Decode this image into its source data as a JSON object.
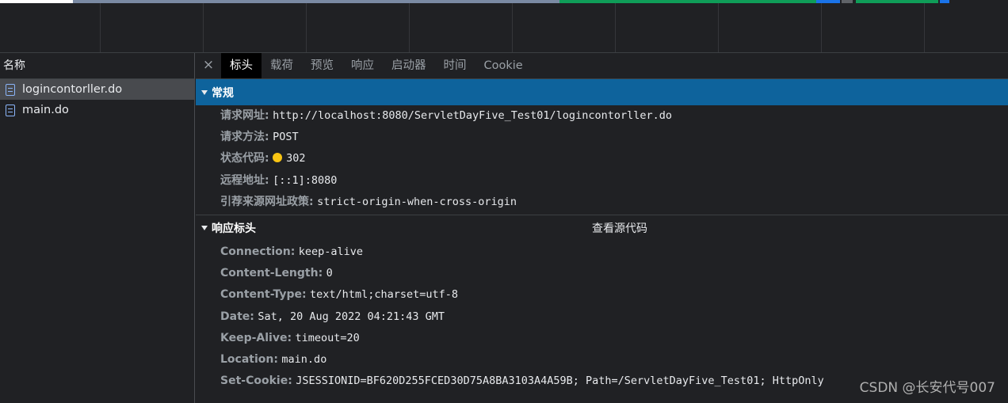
{
  "left": {
    "header": "名称",
    "requests": [
      {
        "name": "logincontorller.do",
        "icon": "document-icon",
        "selected": true
      },
      {
        "name": "main.do",
        "icon": "document-icon",
        "selected": false
      }
    ]
  },
  "tabs": {
    "close": "×",
    "items": [
      "标头",
      "载荷",
      "预览",
      "响应",
      "启动器",
      "时间",
      "Cookie"
    ],
    "active_index": 0
  },
  "general": {
    "title": "常规",
    "rows": [
      {
        "key": "请求网址:",
        "value": "http://localhost:8080/ServletDayFive_Test01/logincontorller.do"
      },
      {
        "key": "请求方法:",
        "value": "POST"
      },
      {
        "key": "状态代码:",
        "value": "302",
        "status_color": "#f9c513"
      },
      {
        "key": "远程地址:",
        "value": "[::1]:8080"
      },
      {
        "key": "引荐来源网址政策:",
        "value": "strict-origin-when-cross-origin"
      }
    ]
  },
  "response_headers": {
    "title": "响应标头",
    "view_source": "查看源代码",
    "rows": [
      {
        "key": "Connection:",
        "value": "keep-alive"
      },
      {
        "key": "Content-Length:",
        "value": "0"
      },
      {
        "key": "Content-Type:",
        "value": "text/html;charset=utf-8"
      },
      {
        "key": "Date:",
        "value": "Sat, 20 Aug 2022 04:21:43 GMT"
      },
      {
        "key": "Keep-Alive:",
        "value": "timeout=20"
      },
      {
        "key": "Location:",
        "value": "main.do"
      },
      {
        "key": "Set-Cookie:",
        "value": "JSESSIONID=BF620D255FCED30D75A8BA3103A4A59B; Path=/ServletDayFive_Test01; HttpOnly"
      }
    ]
  },
  "watermark": "CSDN @长安代号007",
  "colors": {
    "accent": "#0e639c",
    "background": "#202124",
    "timeline_blue": "#4a90d9",
    "timeline_green": "#0f9d58"
  }
}
